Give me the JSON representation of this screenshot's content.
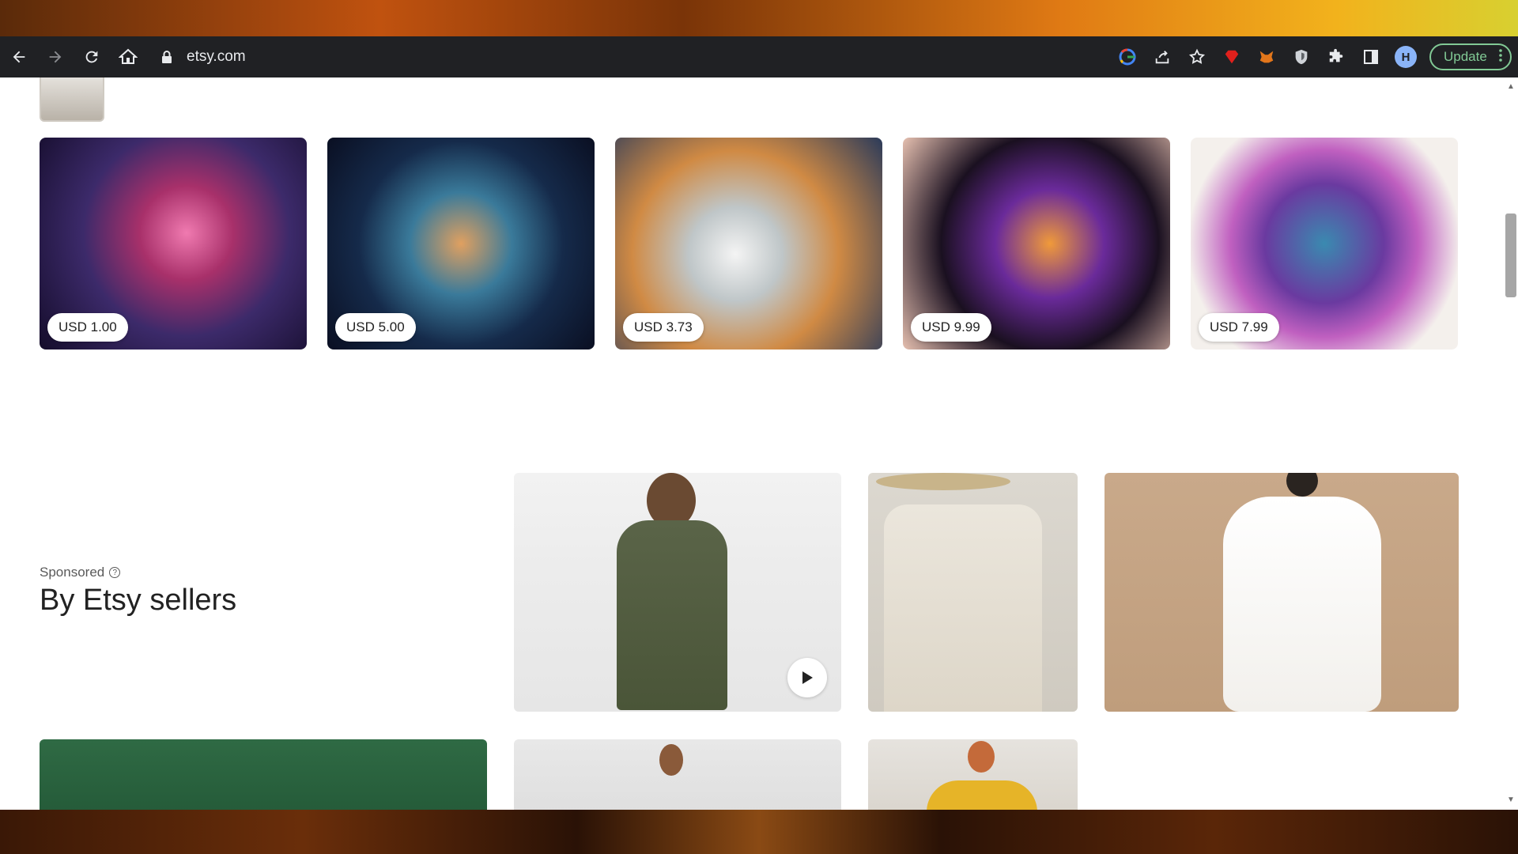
{
  "browser": {
    "url": "etsy.com",
    "update_label": "Update",
    "avatar_initial": "H"
  },
  "listings": [
    {
      "price": "USD 1.00",
      "art": "art-leopard"
    },
    {
      "price": "USD 5.00",
      "art": "art-astro1"
    },
    {
      "price": "USD 3.73",
      "art": "art-panda"
    },
    {
      "price": "USD 9.99",
      "art": "art-astro2"
    },
    {
      "price": "USD 7.99",
      "art": "art-dragon"
    }
  ],
  "sponsored_section": {
    "sponsored_label": "Sponsored",
    "heading": "By Etsy sellers"
  }
}
